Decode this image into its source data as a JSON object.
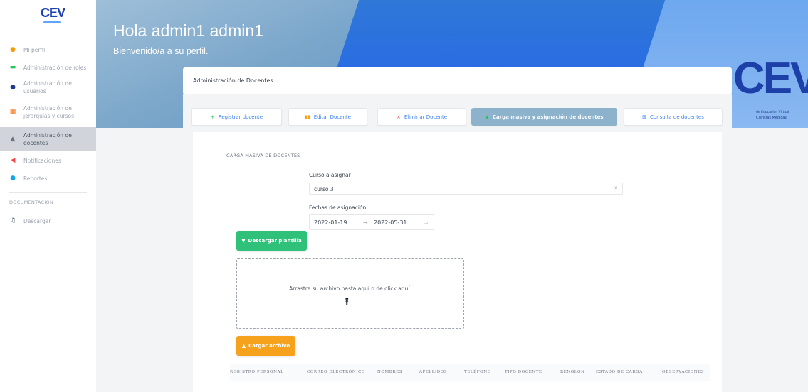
{
  "sidebar": {
    "logo_text": "CEV",
    "items": [
      {
        "label": "Mi perfil",
        "icon": "user-icon",
        "color": "#f59e0b"
      },
      {
        "label": "Administración de roles",
        "icon": "roles-icon",
        "color": "#22c55e"
      },
      {
        "label": "Administración de usuarios",
        "icon": "users-icon",
        "color": "#1e3a8a"
      },
      {
        "label": "Administración de jerarquías y cursos",
        "icon": "hierarchy-icon",
        "color": "#f97316"
      },
      {
        "label": "Administración de docentes",
        "icon": "teacher-icon",
        "color": "#6b7280"
      },
      {
        "label": "Notificaciones",
        "icon": "bell-icon",
        "color": "#ef4444"
      },
      {
        "label": "Reportes",
        "icon": "reports-icon",
        "color": "#0ea5e9"
      }
    ],
    "section_label": "DOCUMENTACIÓN",
    "doc_items": [
      {
        "label": "Descargar",
        "icon": "download-icon",
        "color": "#374151"
      }
    ]
  },
  "header": {
    "greeting": "Hola admin1 admin1",
    "welcome": "Bienvenido/a a su perfil.",
    "brand": "CEV",
    "brand_tag1": "de Educación Virtual",
    "brand_tag2": "Ciencias Médicas"
  },
  "card": {
    "title": "Administración de Docentes"
  },
  "tabs": [
    {
      "label": "Registrar docente",
      "icon": "plus-icon",
      "glyph": "+",
      "color": "#22c55e"
    },
    {
      "label": "Editar Docente",
      "icon": "edit-icon",
      "glyph": "▮▮",
      "color": "#f59e0b"
    },
    {
      "label": "Eliminar Docente",
      "icon": "delete-icon",
      "glyph": "×",
      "color": "#ef4444"
    },
    {
      "label": "Carga masiva y asignación de docentes",
      "icon": "upload-icon",
      "glyph": "▲",
      "color": "#22c55e"
    },
    {
      "label": "Consulta de docentes",
      "icon": "search-icon",
      "glyph": "⊞",
      "color": "#3b82f6"
    }
  ],
  "form": {
    "section_title": "CARGA MASIVA DE DOCENTES",
    "course_label": "Curso a asignar",
    "course_value": "curso 3",
    "dates_label": "Fechas de asignación",
    "date_start": "2022-01-19",
    "date_sep": "→",
    "date_end": "2022-05-31",
    "download_label": "Descargar plantilla",
    "drop_text": "Arrastre su archivo hasta aquí o de click aquí.",
    "upload_label": "Cargar archivo"
  },
  "table": {
    "columns": [
      "REGISTRO PERSONAL",
      "CORREO ELECTRÓNICO",
      "NOMBRES",
      "APELLIDOS",
      "TELÉFONO",
      "TIPO DOCENTE",
      "RENGLÓN",
      "ESTADO DE CARGA",
      "OBSERVACIONES"
    ]
  }
}
